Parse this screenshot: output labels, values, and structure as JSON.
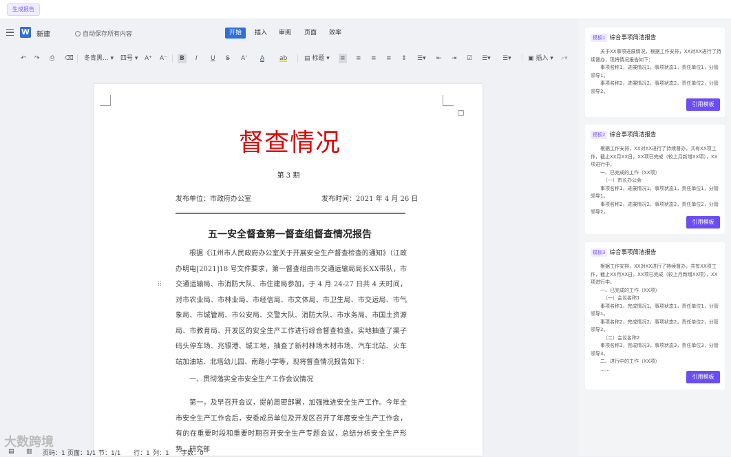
{
  "top": {
    "gen_tab": "生成报告"
  },
  "menubar": {
    "doc_new": "新建",
    "autosave": "自动保存所有内容",
    "tabs": [
      "开始",
      "插入",
      "审阅",
      "页面",
      "效率"
    ]
  },
  "toolbar": {
    "undo": "↶",
    "redo": "↷",
    "format_painter": "⎙",
    "clear": "⌫",
    "font": "冬青黑...",
    "size": "四号",
    "grow": "A⁺",
    "shrink": "A⁻",
    "bold": "B",
    "italic": "I",
    "underline": "U",
    "strike": "S",
    "sup": "A'",
    "font_color": "A",
    "highlight": "ab",
    "heading": "标题",
    "insert": "插入"
  },
  "document": {
    "red_title": "督查情况",
    "issue": "第 3 期",
    "unit": "发布单位：市政府办公室",
    "time": "发布时间：2021 年 4 月 26 日",
    "title": "五一安全督查第一督查组督查情况报告",
    "para1": "根据《江州市人民政府办公室关于开展安全生产督查检查的通知》（江政办明电[2021]18 号文件要求，第一督查组由市交通运输局局长XX带队，市交通运输局、市消防大队、市住建局参加，于 4 月 24-27 日共 4 天时间，对市农业局、市林业局、市经信局、市文体局、市卫生局、市交运局、市气象局、市城管局、市公安局、交警大队、消防大队、市水务局、市国土资源局、市教育局、开发区的安全生产工作进行综合督查检查。实地抽查了渠子码头停车场、兆银港、城工地，抽查了新村林场木材市场、汽车北站、火车站加油站、北塔幼儿园、南路小学等，现将督查情况报告如下：",
    "para2": "一、贯彻落实全市安全生产工作会议情况",
    "para3": "第一，及早召开会议，提前周密部署，加强推进安全生产工作。今年全市安全生产工作会后，安委成员单位及开发区召开了年度安全生产工作会，有的在重要时段和重要时期召开安全生产专题会议，总结分析安全生产形势，研究部"
  },
  "statusbar": {
    "page_no": "页码：1",
    "pages": "页面：1/1",
    "section": "节：1/1",
    "row": "行：1",
    "col": "列：1",
    "chars": "字数：0"
  },
  "watermark": "大数跨境",
  "templates": [
    {
      "badge": "模板1",
      "title": "综合事项简洁报告",
      "lines": [
        "关于XX事项进展情况，根据工作安排，XX对XX进行了持续督办，现将情况报告如下：",
        "事项名称1，进展情况1，事项状态1，责任单位1，分管领导1。",
        "事项名称2，进展情况2，事项状态2，责任单位2，分管领导2。"
      ],
      "button": "引用模板"
    },
    {
      "badge": "模板2",
      "title": "综合事项简洁报告",
      "lines": [
        "根据工作安排，XX对XX进行了持续督办，共有XX项工作，截止XX月XX日，XX项已完成（较上月新增XX项），XX项进行中。",
        "一、已完成的工作（XX项）",
        "（一）市长办公会",
        "事项名称1，进展情况1，事项状态1，责任单位1，分管领导1。",
        "事项名称2，进展情况2，事项状态2，责任单位2，分管领导2。"
      ],
      "button": "引用模板"
    },
    {
      "badge": "模板3",
      "title": "综合事项简洁报告",
      "lines": [
        "根据工作安排，XX对XX进行了持续督办，共有XX项工作，截止XX月XX日，XX项已完成（较上月新增XX项），XX项进行中。",
        "一、已完成的工作（XX项）",
        "（一）会议名称1",
        "事项名称1，完成情况1，事项状态1，责任单位1，分管领导1。",
        "事项名称2，完成情况2，事项状态2，责任单位2，分管领导2。",
        "（二）会议名称2",
        "事项名称3，完成情况3，事项状态3，责任单位3，分管领导3。",
        "二、进行中的工作（XX项）",
        "……"
      ],
      "button": "引用模板"
    }
  ]
}
